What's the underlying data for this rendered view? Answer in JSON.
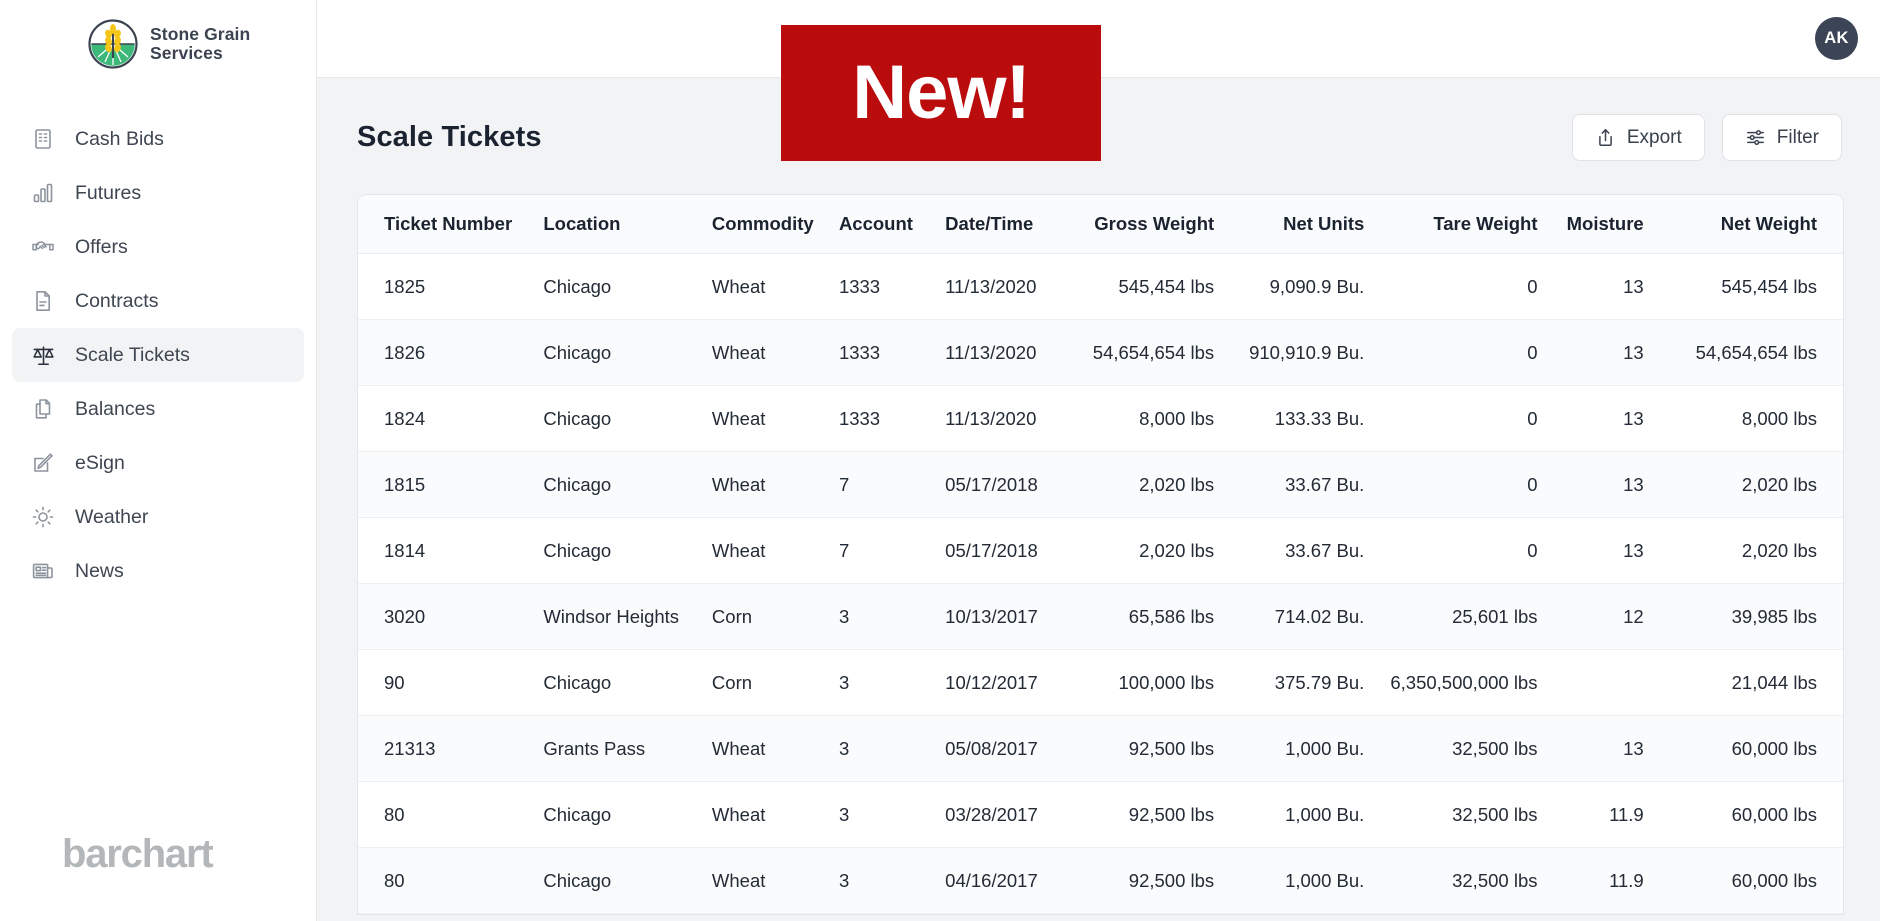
{
  "brand": {
    "name_line1": "Stone Grain",
    "name_line2": "Services",
    "logo_icon": "wheat-field-circle-logo",
    "footer_logo": "barchart"
  },
  "sidebar": {
    "items": [
      {
        "label": "Cash Bids",
        "icon": "building-icon",
        "active": false
      },
      {
        "label": "Futures",
        "icon": "bar-chart-icon",
        "active": false
      },
      {
        "label": "Offers",
        "icon": "handshake-icon",
        "active": false
      },
      {
        "label": "Contracts",
        "icon": "document-icon",
        "active": false
      },
      {
        "label": "Scale Tickets",
        "icon": "scales-icon",
        "active": true
      },
      {
        "label": "Balances",
        "icon": "copy-pages-icon",
        "active": false
      },
      {
        "label": "eSign",
        "icon": "pencil-square-icon",
        "active": false
      },
      {
        "label": "Weather",
        "icon": "sun-icon",
        "active": false
      },
      {
        "label": "News",
        "icon": "newspaper-icon",
        "active": false
      }
    ]
  },
  "topbar": {
    "avatar_initials": "AK"
  },
  "banner": {
    "text": "New!",
    "color": "#ba0c0c"
  },
  "page": {
    "title": "Scale Tickets",
    "export_label": "Export",
    "export_icon": "share-upload-icon",
    "filter_label": "Filter",
    "filter_icon": "sliders-icon"
  },
  "table": {
    "columns": [
      {
        "label": "Ticket Number",
        "align": "left"
      },
      {
        "label": "Location",
        "align": "left"
      },
      {
        "label": "Commodity",
        "align": "left"
      },
      {
        "label": "Account",
        "align": "left"
      },
      {
        "label": "Date/Time",
        "align": "left"
      },
      {
        "label": "Gross Weight",
        "align": "right"
      },
      {
        "label": "Net Units",
        "align": "right"
      },
      {
        "label": "Tare Weight",
        "align": "right"
      },
      {
        "label": "Moisture",
        "align": "right"
      },
      {
        "label": "Net Weight",
        "align": "right"
      }
    ],
    "rows": [
      [
        "1825",
        "Chicago",
        "Wheat",
        "1333",
        "11/13/2020",
        "545,454 lbs",
        "9,090.9 Bu.",
        "0",
        "13",
        "545,454 lbs"
      ],
      [
        "1826",
        "Chicago",
        "Wheat",
        "1333",
        "11/13/2020",
        "54,654,654 lbs",
        "910,910.9 Bu.",
        "0",
        "13",
        "54,654,654 lbs"
      ],
      [
        "1824",
        "Chicago",
        "Wheat",
        "1333",
        "11/13/2020",
        "8,000 lbs",
        "133.33 Bu.",
        "0",
        "13",
        "8,000 lbs"
      ],
      [
        "1815",
        "Chicago",
        "Wheat",
        "7",
        "05/17/2018",
        "2,020 lbs",
        "33.67 Bu.",
        "0",
        "13",
        "2,020 lbs"
      ],
      [
        "1814",
        "Chicago",
        "Wheat",
        "7",
        "05/17/2018",
        "2,020 lbs",
        "33.67 Bu.",
        "0",
        "13",
        "2,020 lbs"
      ],
      [
        "3020",
        "Windsor Heights",
        "Corn",
        "3",
        "10/13/2017",
        "65,586 lbs",
        "714.02 Bu.",
        "25,601 lbs",
        "12",
        "39,985 lbs"
      ],
      [
        "90",
        "Chicago",
        "Corn",
        "3",
        "10/12/2017",
        "100,000 lbs",
        "375.79 Bu.",
        "6,350,500,000 lbs",
        "",
        "21,044 lbs"
      ],
      [
        "21313",
        "Grants Pass",
        "Wheat",
        "3",
        "05/08/2017",
        "92,500 lbs",
        "1,000 Bu.",
        "32,500 lbs",
        "13",
        "60,000 lbs"
      ],
      [
        "80",
        "Chicago",
        "Wheat",
        "3",
        "03/28/2017",
        "92,500 lbs",
        "1,000 Bu.",
        "32,500 lbs",
        "11.9",
        "60,000 lbs"
      ],
      [
        "80",
        "Chicago",
        "Wheat",
        "3",
        "04/16/2017",
        "92,500 lbs",
        "1,000 Bu.",
        "32,500 lbs",
        "11.9",
        "60,000 lbs"
      ]
    ]
  }
}
